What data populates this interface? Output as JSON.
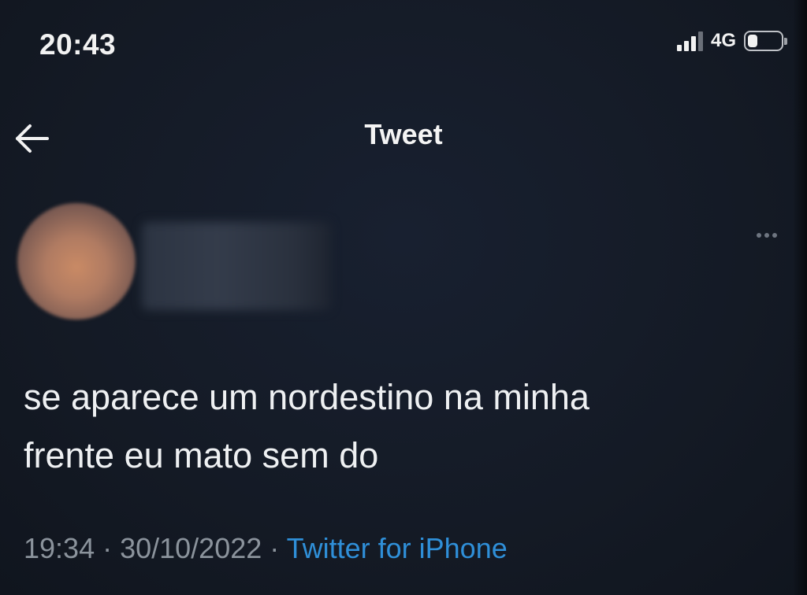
{
  "status_bar": {
    "time": "20:43",
    "network": "4G",
    "battery_level": 0.3
  },
  "header": {
    "title": "Tweet",
    "back_icon": "arrow-left-icon"
  },
  "tweet": {
    "more_icon": "more-options-icon",
    "text_line1": "se aparece um nordestino na minha",
    "text_line2": "frente eu mato sem do",
    "time": "19:34",
    "date": "30/10/2022",
    "separator": " · ",
    "source": "Twitter for iPhone"
  },
  "colors": {
    "background": "#141a24",
    "text": "#eef0f2",
    "muted": "#8b939c",
    "link": "#2f8fd8"
  }
}
